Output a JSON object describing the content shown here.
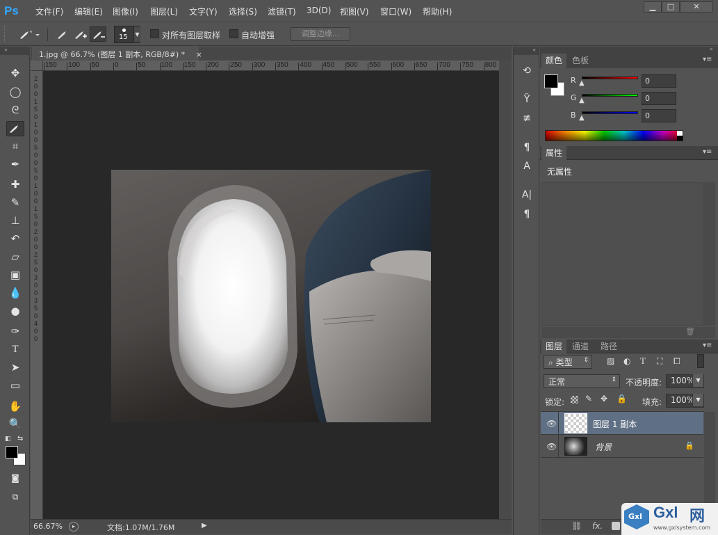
{
  "app": {
    "logo": "Ps"
  },
  "menu": [
    "文件(F)",
    "编辑(E)",
    "图像(I)",
    "图层(L)",
    "文字(Y)",
    "选择(S)",
    "滤镜(T)",
    "3D(D)",
    "视图(V)",
    "窗口(W)",
    "帮助(H)"
  ],
  "window_controls": {
    "minimize": "▁",
    "maximize": "□",
    "close": "✕"
  },
  "options": {
    "brush_size": "15",
    "sample_all_layers": "对所有图层取样",
    "auto_enhance": "自动增强",
    "refine_edge": "调整边缘..."
  },
  "document": {
    "tab_title": "1.jpg @ 66.7% (图层 1 副本, RGB/8#) *",
    "close": "×"
  },
  "rulers": {
    "top": [
      "150",
      "100",
      "50",
      "0",
      "50",
      "100",
      "150",
      "200",
      "250",
      "300",
      "350",
      "400",
      "450",
      "500",
      "550",
      "600",
      "650",
      "700",
      "750",
      "800"
    ],
    "left": [
      "2",
      "0",
      "0",
      "1",
      "5",
      "0",
      "1",
      "0",
      "0",
      "5",
      "0",
      "0",
      "5",
      "0",
      "1",
      "0",
      "0",
      "1",
      "5",
      "0",
      "2",
      "0",
      "0",
      "2",
      "5",
      "0",
      "3",
      "0",
      "0",
      "3",
      "5",
      "0",
      "4",
      "0",
      "0"
    ]
  },
  "status": {
    "zoom": "66.67%",
    "doc": "文档:1.07M/1.76M"
  },
  "color_panel": {
    "tabs": [
      "颜色",
      "色板"
    ],
    "channels": [
      {
        "label": "R",
        "value": "0"
      },
      {
        "label": "G",
        "value": "0"
      },
      {
        "label": "B",
        "value": "0"
      }
    ],
    "fg": "#000000",
    "bg": "#ffffff"
  },
  "properties_panel": {
    "tab": "属性",
    "empty_text": "无属性"
  },
  "layers_panel": {
    "tabs": [
      "图层",
      "通道",
      "路径"
    ],
    "filter_kind": "类型",
    "blend_mode": "正常",
    "opacity_label": "不透明度:",
    "opacity": "100%",
    "lock_label": "锁定:",
    "fill_label": "填充:",
    "fill": "100%",
    "layers": [
      {
        "name": "图层 1 副本",
        "selected": true
      },
      {
        "name": "背景",
        "selected": false,
        "locked": true
      }
    ],
    "footer_fx": "fx."
  },
  "watermark": {
    "logo": "Gxl",
    "site": "www.gxlsystem.com",
    "char": "网"
  }
}
